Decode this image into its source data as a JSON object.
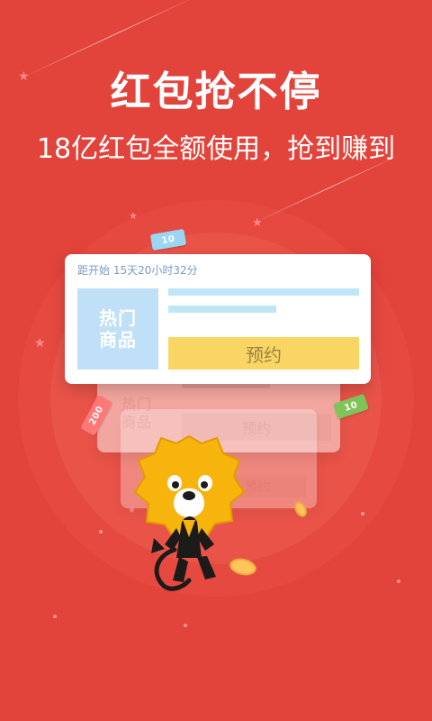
{
  "promo": {
    "headline": "红包抢不停",
    "subtitle": "18亿红包全额使用，抢到赚到"
  },
  "card": {
    "countdown": "距开始 15天20小时32分",
    "product_label": {
      "line_1": "热门",
      "line_2": "商品"
    },
    "reserve_label": "预约"
  },
  "stacked_cards": {
    "card_2": {
      "product_label": {
        "line_1": "热门",
        "line_2": "商品"
      },
      "reserve_label": "预约"
    },
    "card_3": {
      "reserve_label": "预约"
    }
  },
  "coupons": {
    "top_left": "10",
    "left": "200",
    "right": "10"
  },
  "colors": {
    "background": "#e2433b",
    "accent": "#f9d563",
    "product_tile": "#bfe0f6",
    "text_light": "#ffffff"
  },
  "icons": {
    "mascot": "lion-mascot-icon",
    "stars": "star-icon",
    "coins": "coin-icon"
  }
}
